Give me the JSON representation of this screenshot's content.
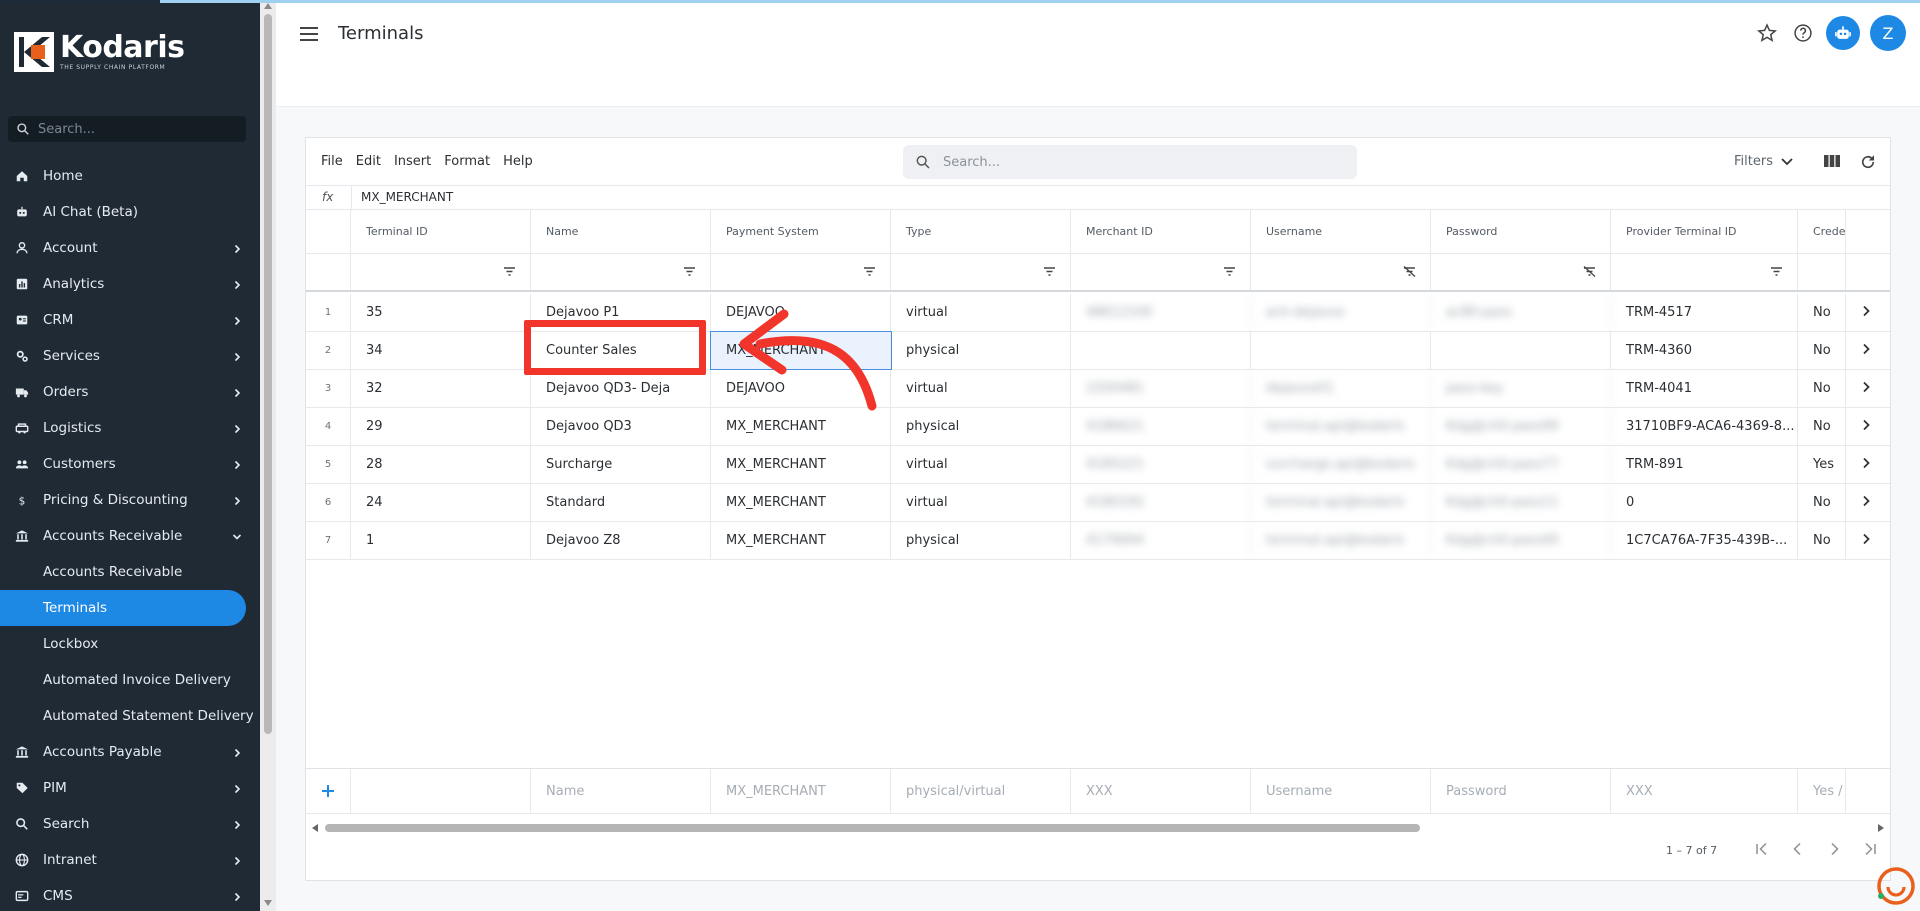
{
  "sidebar": {
    "logo": {
      "name": "Kodaris",
      "tagline": "THE SUPPLY CHAIN PLATFORM"
    },
    "search_placeholder": "Search...",
    "items": [
      {
        "label": "Home",
        "icon": "home-icon",
        "chevron": false
      },
      {
        "label": "AI Chat (Beta)",
        "icon": "robot-icon",
        "chevron": false
      },
      {
        "label": "Account",
        "icon": "person-icon",
        "chevron": true
      },
      {
        "label": "Analytics",
        "icon": "analytics-icon",
        "chevron": true
      },
      {
        "label": "CRM",
        "icon": "contact-card-icon",
        "chevron": true
      },
      {
        "label": "Services",
        "icon": "services-icon",
        "chevron": true
      },
      {
        "label": "Orders",
        "icon": "truck-icon",
        "chevron": true
      },
      {
        "label": "Logistics",
        "icon": "logistics-icon",
        "chevron": true
      },
      {
        "label": "Customers",
        "icon": "group-icon",
        "chevron": true
      },
      {
        "label": "Pricing & Discounting",
        "icon": "dollar-icon",
        "chevron": true
      },
      {
        "label": "Accounts Receivable",
        "icon": "bank-icon",
        "chevron": "down"
      },
      {
        "label": "Accounts Receivable",
        "sub": true
      },
      {
        "label": "Terminals",
        "sub": true,
        "active": true
      },
      {
        "label": "Lockbox",
        "sub": true
      },
      {
        "label": "Automated Invoice Delivery",
        "sub": true
      },
      {
        "label": "Automated Statement Delivery",
        "sub": true
      },
      {
        "label": "Accounts Payable",
        "icon": "bank-icon",
        "chevron": true
      },
      {
        "label": "PIM",
        "icon": "tag-icon",
        "chevron": true
      },
      {
        "label": "Search",
        "icon": "search-icon",
        "chevron": true
      },
      {
        "label": "Intranet",
        "icon": "globe-icon",
        "chevron": true
      },
      {
        "label": "CMS",
        "icon": "cms-icon",
        "chevron": true
      }
    ]
  },
  "header": {
    "title": "Terminals",
    "avatar_initial": "Z"
  },
  "toolbar": {
    "menu": [
      "File",
      "Edit",
      "Insert",
      "Format",
      "Help"
    ],
    "search_placeholder": "Search...",
    "filters_label": "Filters"
  },
  "formula": {
    "fx": "fx",
    "value": "MX_MERCHANT"
  },
  "table": {
    "columns": [
      "Terminal ID",
      "Name",
      "Payment System",
      "Type",
      "Merchant ID",
      "Username",
      "Password",
      "Provider Terminal ID",
      "Credentials"
    ],
    "rows": [
      {
        "n": "1",
        "id": "35",
        "name": "Dejavoo P1",
        "ps": "DEJAVOO",
        "type": "virtual",
        "mid": "48612100",
        "user": "ack-dejavoo",
        "pw": "ac80-pass",
        "ptid": "TRM-4517",
        "cred": "No"
      },
      {
        "n": "2",
        "id": "34",
        "name": "Counter Sales",
        "ps": "MX_MERCHANT",
        "type": "physical",
        "mid": "",
        "user": "",
        "pw": "",
        "ptid": "TRM-4360",
        "cred": "No"
      },
      {
        "n": "3",
        "id": "32",
        "name": "Dejavoo QD3- Deja",
        "ps": "DEJAVOO",
        "type": "virtual",
        "mid": "2200481",
        "user": "dejavoo01",
        "pw": "pass-key",
        "ptid": "TRM-4041",
        "cred": "No"
      },
      {
        "n": "4",
        "id": "29",
        "name": "Dejavoo QD3",
        "ps": "MX_MERCHANT",
        "type": "physical",
        "mid": "4186621",
        "user": "terminal.api@kodaris",
        "pw": "Kdg@ch0-pass99",
        "ptid": "31710BF9-ACA6-4369-8...",
        "cred": "No"
      },
      {
        "n": "5",
        "id": "28",
        "name": "Surcharge",
        "ps": "MX_MERCHANT",
        "type": "virtual",
        "mid": "4185221",
        "user": "surcharge.api@kodaris",
        "pw": "Kdg@ch0-pass77",
        "ptid": "TRM-891",
        "cred": "Yes"
      },
      {
        "n": "6",
        "id": "24",
        "name": "Standard",
        "ps": "MX_MERCHANT",
        "type": "virtual",
        "mid": "4180192",
        "user": "terminal.api@kodaris",
        "pw": "Kdg@ch0-pass11",
        "ptid": "0",
        "cred": "No"
      },
      {
        "n": "7",
        "id": "1",
        "name": "Dejavoo Z8",
        "ps": "MX_MERCHANT",
        "type": "physical",
        "mid": "4179004",
        "user": "terminal.api@kodaris",
        "pw": "Kdg@ch0-pass00",
        "ptid": "1C7CA76A-7F35-439B-...",
        "cred": "No"
      }
    ],
    "add_row": {
      "name": "Name",
      "ps": "MX_MERCHANT",
      "type": "physical/virtual",
      "mid": "XXX",
      "user": "Username",
      "pw": "Password",
      "ptid": "XXX",
      "cred": "Yes / No"
    }
  },
  "pager": {
    "text": "1 – 7 of 7"
  },
  "colors": {
    "sidebar": "#1f2a35",
    "accent": "#1e88e5",
    "annotation": "#f2352a"
  }
}
